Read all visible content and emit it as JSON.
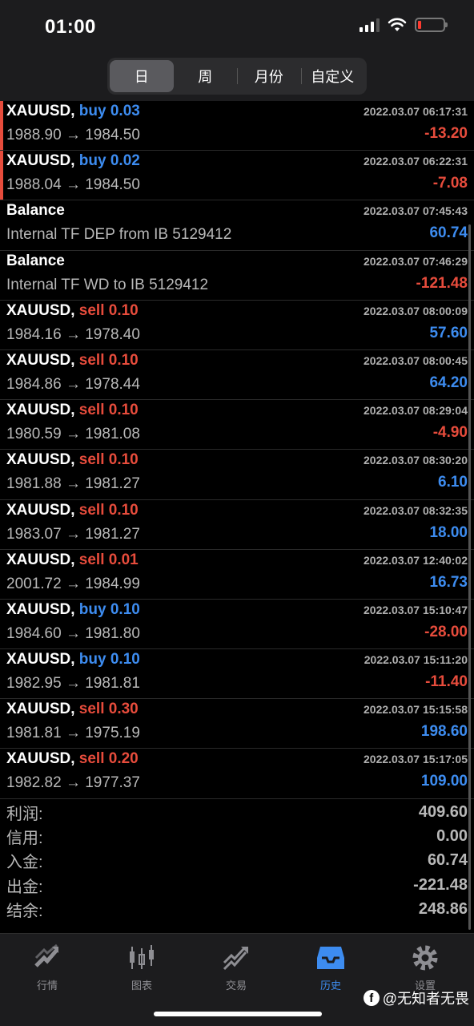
{
  "status_bar": {
    "time": "01:00"
  },
  "segments": [
    {
      "label": "日",
      "active": true
    },
    {
      "label": "周",
      "active": false
    },
    {
      "label": "月份",
      "active": false
    },
    {
      "label": "自定义",
      "active": false
    }
  ],
  "rows": [
    {
      "symbol": "XAUUSD,",
      "type": "buy",
      "type_label": "buy 0.03",
      "prices": "1988.90 → 1984.50",
      "date": "2022.03.07 06:17:31",
      "profit": "-13.20",
      "sign": "neg",
      "marked": true
    },
    {
      "symbol": "XAUUSD,",
      "type": "buy",
      "type_label": "buy 0.02",
      "prices": "1988.04 → 1984.50",
      "date": "2022.03.07 06:22:31",
      "profit": "-7.08",
      "sign": "neg",
      "marked": true
    },
    {
      "symbol": "Balance",
      "type": "balance",
      "type_label": "",
      "prices": "Internal TF DEP from IB 5129412",
      "date": "2022.03.07 07:45:43",
      "profit": "60.74",
      "sign": "pos",
      "marked": false
    },
    {
      "symbol": "Balance",
      "type": "balance",
      "type_label": "",
      "prices": "Internal TF WD to IB 5129412",
      "date": "2022.03.07 07:46:29",
      "profit": "-121.48",
      "sign": "neg",
      "marked": false
    },
    {
      "symbol": "XAUUSD,",
      "type": "sell",
      "type_label": "sell 0.10",
      "prices": "1984.16 → 1978.40",
      "date": "2022.03.07 08:00:09",
      "profit": "57.60",
      "sign": "pos",
      "marked": false
    },
    {
      "symbol": "XAUUSD,",
      "type": "sell",
      "type_label": "sell 0.10",
      "prices": "1984.86 → 1978.44",
      "date": "2022.03.07 08:00:45",
      "profit": "64.20",
      "sign": "pos",
      "marked": false
    },
    {
      "symbol": "XAUUSD,",
      "type": "sell",
      "type_label": "sell 0.10",
      "prices": "1980.59 → 1981.08",
      "date": "2022.03.07 08:29:04",
      "profit": "-4.90",
      "sign": "neg",
      "marked": false
    },
    {
      "symbol": "XAUUSD,",
      "type": "sell",
      "type_label": "sell 0.10",
      "prices": "1981.88 → 1981.27",
      "date": "2022.03.07 08:30:20",
      "profit": "6.10",
      "sign": "pos",
      "marked": false
    },
    {
      "symbol": "XAUUSD,",
      "type": "sell",
      "type_label": "sell 0.10",
      "prices": "1983.07 → 1981.27",
      "date": "2022.03.07 08:32:35",
      "profit": "18.00",
      "sign": "pos",
      "marked": false
    },
    {
      "symbol": "XAUUSD,",
      "type": "sell",
      "type_label": "sell 0.01",
      "prices": "2001.72 → 1984.99",
      "date": "2022.03.07 12:40:02",
      "profit": "16.73",
      "sign": "pos",
      "marked": false
    },
    {
      "symbol": "XAUUSD,",
      "type": "buy",
      "type_label": "buy 0.10",
      "prices": "1984.60 → 1981.80",
      "date": "2022.03.07 15:10:47",
      "profit": "-28.00",
      "sign": "neg",
      "marked": false
    },
    {
      "symbol": "XAUUSD,",
      "type": "buy",
      "type_label": "buy 0.10",
      "prices": "1982.95 → 1981.81",
      "date": "2022.03.07 15:11:20",
      "profit": "-11.40",
      "sign": "neg",
      "marked": false
    },
    {
      "symbol": "XAUUSD,",
      "type": "sell",
      "type_label": "sell 0.30",
      "prices": "1981.81 → 1975.19",
      "date": "2022.03.07 15:15:58",
      "profit": "198.60",
      "sign": "pos",
      "marked": false
    },
    {
      "symbol": "XAUUSD,",
      "type": "sell",
      "type_label": "sell 0.20",
      "prices": "1982.82 → 1977.37",
      "date": "2022.03.07 15:17:05",
      "profit": "109.00",
      "sign": "pos",
      "marked": false
    }
  ],
  "summary": [
    {
      "label": "利润:",
      "value": "409.60"
    },
    {
      "label": "信用:",
      "value": "0.00"
    },
    {
      "label": "入金:",
      "value": "60.74"
    },
    {
      "label": "出金:",
      "value": "-221.48"
    },
    {
      "label": "结余:",
      "value": "248.86"
    }
  ],
  "tabs": [
    {
      "label": "行情",
      "icon": "quotes-icon",
      "active": false
    },
    {
      "label": "图表",
      "icon": "chart-icon",
      "active": false
    },
    {
      "label": "交易",
      "icon": "trade-icon",
      "active": false
    },
    {
      "label": "历史",
      "icon": "history-icon",
      "active": true
    },
    {
      "label": "设置",
      "icon": "settings-icon",
      "active": false
    }
  ],
  "watermark": "@无知者无畏",
  "colors": {
    "buy": "#3d8cf0",
    "sell": "#e74c3c",
    "active_tab": "#3d8cf0"
  }
}
